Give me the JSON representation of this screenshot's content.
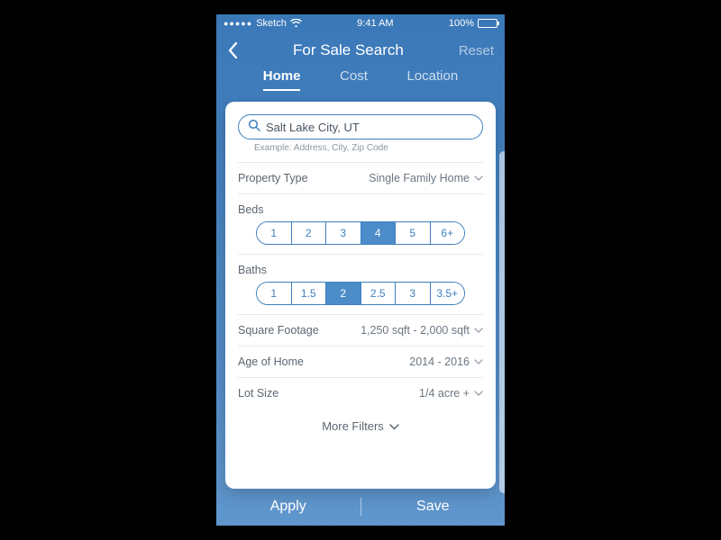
{
  "status": {
    "carrier": "Sketch",
    "time": "9:41 AM",
    "battery": "100%"
  },
  "nav": {
    "title": "For Sale Search",
    "reset": "Reset"
  },
  "tabs": {
    "home": "Home",
    "cost": "Cost",
    "location": "Location"
  },
  "search": {
    "value": "Salt Lake City, UT",
    "hint": "Example: Address, City, Zip Code"
  },
  "propertyType": {
    "label": "Property Type",
    "value": "Single Family Home"
  },
  "beds": {
    "label": "Beds",
    "options": [
      "1",
      "2",
      "3",
      "4",
      "5",
      "6+"
    ],
    "selected": "4"
  },
  "baths": {
    "label": "Baths",
    "options": [
      "1",
      "1.5",
      "2",
      "2.5",
      "3",
      "3.5+"
    ],
    "selected": "2"
  },
  "sqft": {
    "label": "Square Footage",
    "value": "1,250 sqft - 2,000 sqft"
  },
  "age": {
    "label": "Age of Home",
    "value": "2014 - 2016"
  },
  "lot": {
    "label": "Lot Size",
    "value": "1/4 acre +"
  },
  "moreFilters": "More Filters",
  "bottom": {
    "apply": "Apply",
    "save": "Save"
  }
}
